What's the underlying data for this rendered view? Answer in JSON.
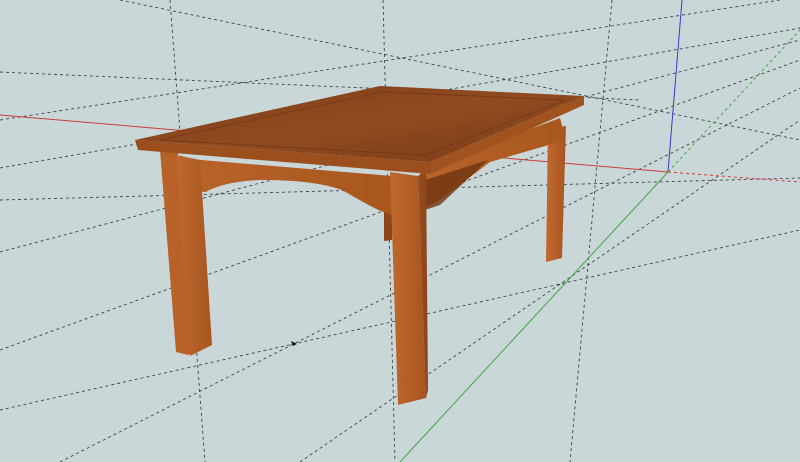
{
  "viewport": {
    "background": "#c9d7d9",
    "axes": {
      "red": "#cc3b3b",
      "green": "#3fa83f",
      "blue": "#3a3ad6"
    }
  },
  "model": {
    "object": "table",
    "wood_light": "#b8602b",
    "wood_mid": "#a0521f",
    "wood_dark": "#7a3b16",
    "top_color": "#8c4a1f"
  },
  "cursor_icon": "arrow-cursor-icon"
}
